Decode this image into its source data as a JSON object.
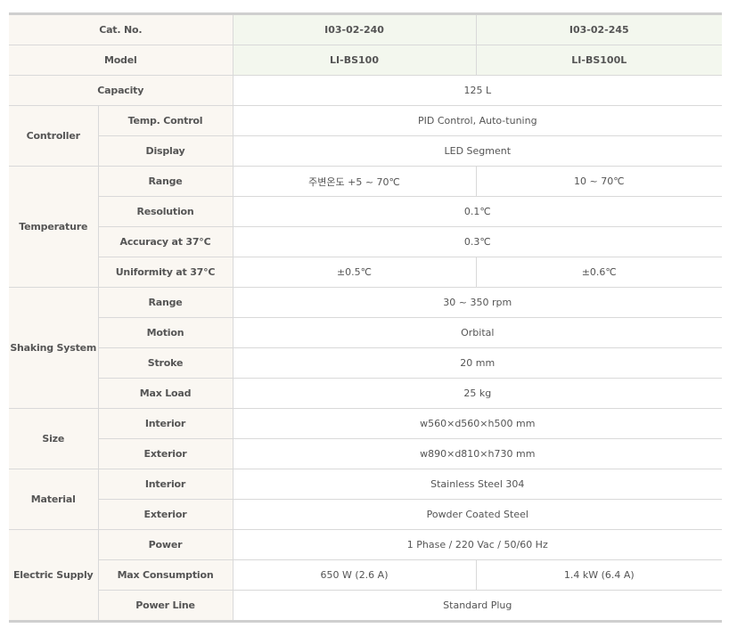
{
  "header": {
    "cat_no": {
      "label": "Cat. No.",
      "values": [
        "I03-02-240",
        "I03-02-245"
      ]
    },
    "model": {
      "label": "Model",
      "values": [
        "LI-BS100",
        "LI-BS100L"
      ]
    }
  },
  "capacity": {
    "label": "Capacity",
    "value": "125 L"
  },
  "controller": {
    "label": "Controller",
    "temp_control": {
      "label": "Temp. Control",
      "value": "PID Control, Auto-tuning"
    },
    "display": {
      "label": "Display",
      "value": "LED Segment"
    }
  },
  "temperature": {
    "label": "Temperature",
    "range": {
      "label": "Range",
      "values": [
        "주변온도 +5 ~ 70℃",
        "10 ~ 70℃"
      ]
    },
    "resolution": {
      "label": "Resolution",
      "value": "0.1℃"
    },
    "accuracy": {
      "label": "Accuracy at 37°C",
      "value": "0.3℃"
    },
    "uniformity": {
      "label": "Uniformity at 37°C",
      "values": [
        "±0.5℃",
        "±0.6℃"
      ]
    }
  },
  "shaking": {
    "label": "Shaking System",
    "range": {
      "label": "Range",
      "value": "30 ~ 350 rpm"
    },
    "motion": {
      "label": "Motion",
      "value": "Orbital"
    },
    "stroke": {
      "label": "Stroke",
      "value": "20 mm"
    },
    "max_load": {
      "label": "Max Load",
      "value": "25 kg"
    }
  },
  "size": {
    "label": "Size",
    "interior": {
      "label": "Interior",
      "value": "w560×d560×h500 mm"
    },
    "exterior": {
      "label": "Exterior",
      "value": "w890×d810×h730 mm"
    }
  },
  "material": {
    "label": "Material",
    "interior": {
      "label": "Interior",
      "value": "Stainless Steel 304"
    },
    "exterior": {
      "label": "Exterior",
      "value": "Powder Coated Steel"
    }
  },
  "electric": {
    "label": "Electric Supply",
    "power": {
      "label": "Power",
      "value": "1 Phase / 220 Vac / 50/60 Hz"
    },
    "max_consumption": {
      "label": "Max Consumption",
      "values": [
        "650 W (2.6 A)",
        "1.4 kW (6.4 A)"
      ]
    },
    "power_line": {
      "label": "Power Line",
      "value": "Standard Plug"
    }
  }
}
